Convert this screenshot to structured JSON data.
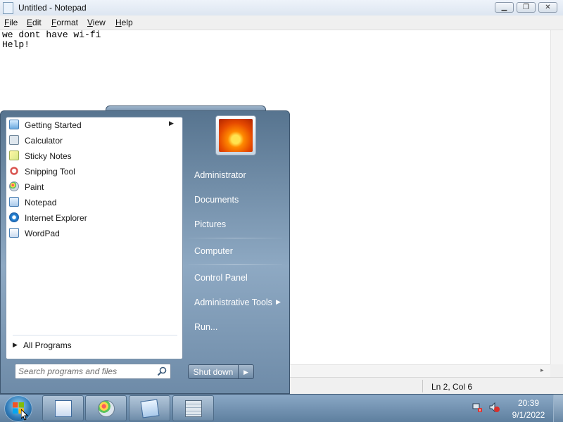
{
  "window": {
    "title": "Untitled - Notepad",
    "minimize_icon": "minimize-icon",
    "maximize_icon": "restore-icon",
    "close_icon": "close-icon"
  },
  "menubar": {
    "items": [
      {
        "first": "F",
        "rest": "ile"
      },
      {
        "first": "E",
        "rest": "dit"
      },
      {
        "first": "F",
        "rest": "ormat"
      },
      {
        "first": "V",
        "rest": "iew"
      },
      {
        "first": "H",
        "rest": "elp"
      }
    ]
  },
  "editor": {
    "text": "we dont have wi-fi\nHelp!"
  },
  "statusbar": {
    "position": "Ln 2, Col 6"
  },
  "start_menu": {
    "programs": [
      {
        "label": "Getting Started",
        "icon": "getting-started-icon",
        "has_submenu": true
      },
      {
        "label": "Calculator",
        "icon": "calculator-icon"
      },
      {
        "label": "Sticky Notes",
        "icon": "sticky-notes-icon"
      },
      {
        "label": "Snipping Tool",
        "icon": "snipping-tool-icon"
      },
      {
        "label": "Paint",
        "icon": "paint-icon"
      },
      {
        "label": "Notepad",
        "icon": "notepad-icon"
      },
      {
        "label": "Internet Explorer",
        "icon": "internet-explorer-icon"
      },
      {
        "label": "WordPad",
        "icon": "wordpad-icon"
      }
    ],
    "all_programs": "All Programs",
    "search": {
      "placeholder": "Search programs and files"
    },
    "right_items": [
      {
        "label": "Administrator"
      },
      {
        "label": "Documents"
      },
      {
        "label": "Pictures"
      },
      {
        "label": "Computer"
      },
      {
        "label": "Control Panel"
      },
      {
        "label": "Administrative Tools",
        "has_submenu": true
      },
      {
        "label": "Run..."
      }
    ],
    "shutdown": "Shut down"
  },
  "taskbar": {
    "pinned": [
      {
        "icon": "wordpad-icon"
      },
      {
        "icon": "paint-icon"
      },
      {
        "icon": "notepad-icon"
      },
      {
        "icon": "calculator-icon"
      }
    ],
    "tray": {
      "network_icon": "network-disconnected-icon",
      "volume_icon": "volume-muted-icon"
    },
    "clock": {
      "time": "20:39",
      "date": "9/1/2022"
    }
  },
  "colors": {
    "start_menu_bg": "#6e8ba8",
    "taskbar_bg": "#7394b4",
    "menu_accent": "#ffffff"
  }
}
